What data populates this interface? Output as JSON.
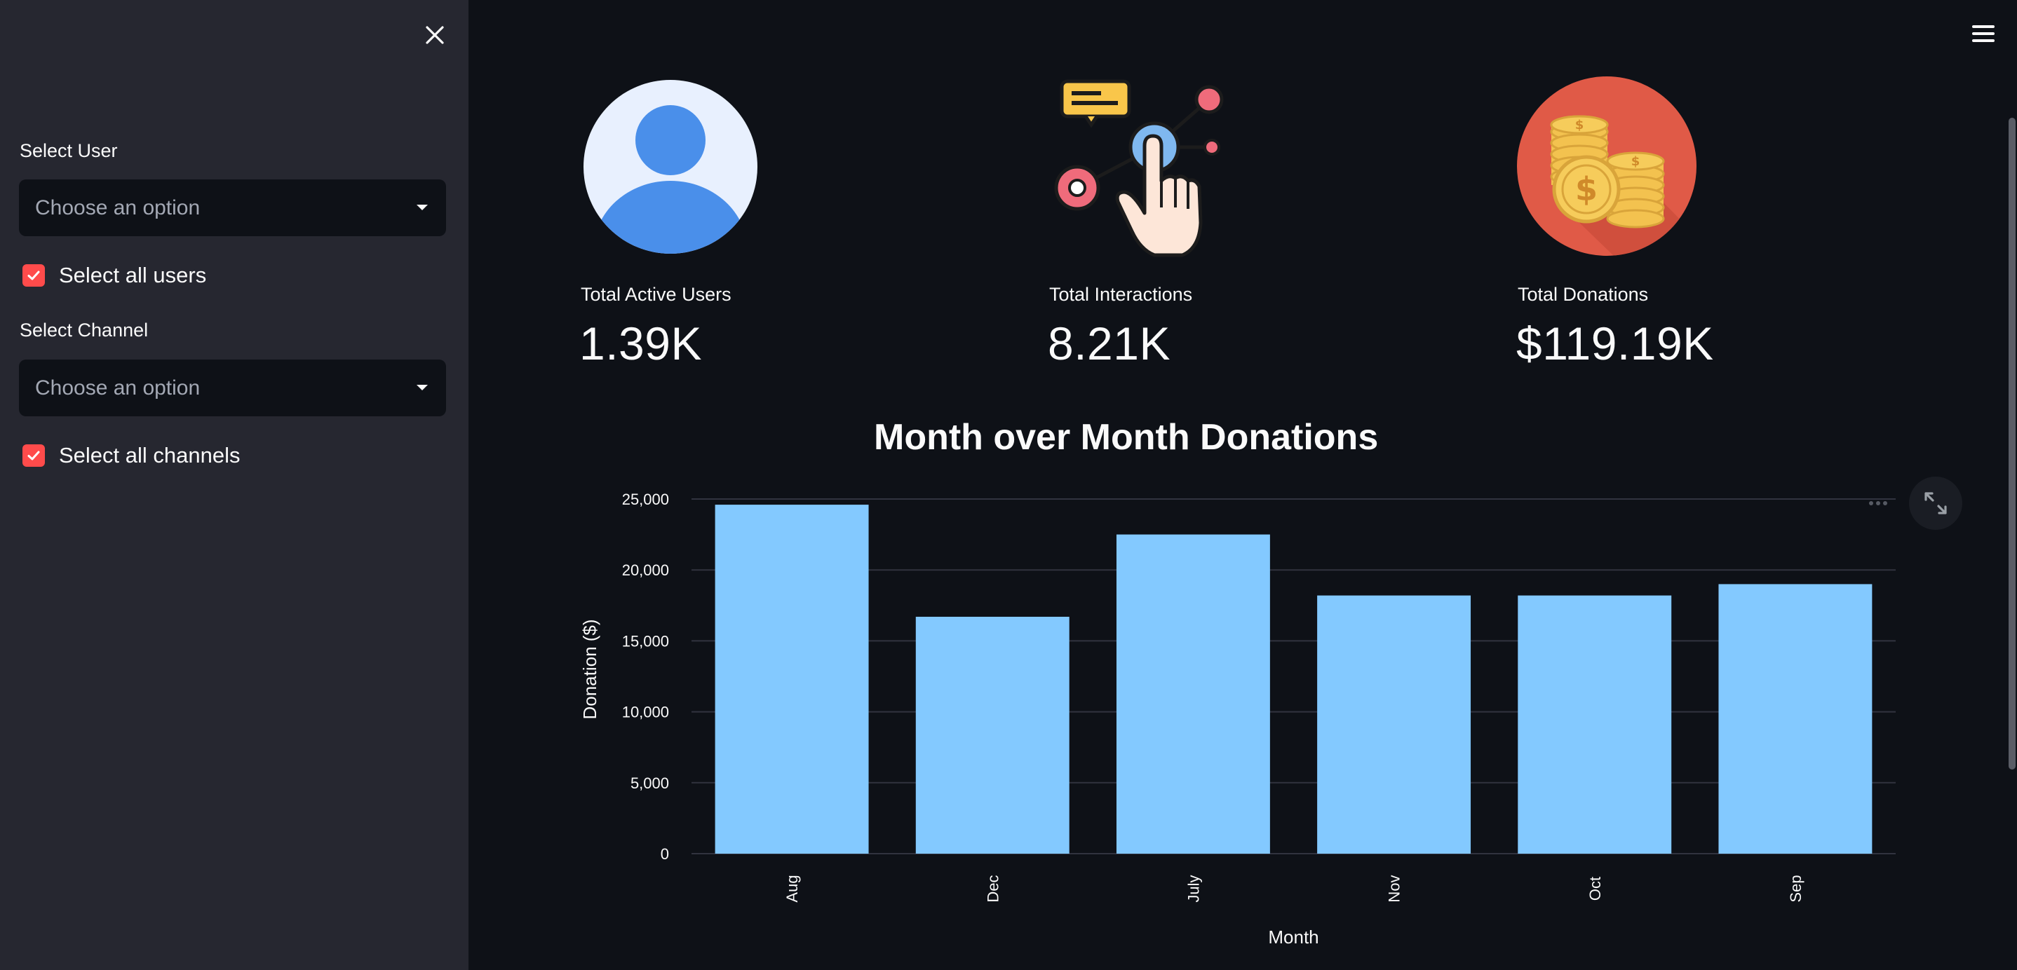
{
  "sidebar": {
    "select_user": {
      "label": "Select User",
      "placeholder": "Choose an option"
    },
    "select_all_users": {
      "label": "Select all users",
      "checked": true
    },
    "select_channel": {
      "label": "Select Channel",
      "placeholder": "Choose an option"
    },
    "select_all_channels": {
      "label": "Select all channels",
      "checked": true
    },
    "close_icon": "close-icon"
  },
  "header": {
    "menu_icon": "hamburger-menu-icon"
  },
  "metrics": [
    {
      "label": "Total Active Users",
      "value": "1.39K",
      "icon": "user-avatar-icon"
    },
    {
      "label": "Total Interactions",
      "value": "8.21K",
      "icon": "interaction-hand-icon"
    },
    {
      "label": "Total Donations",
      "value": "$119.19K",
      "icon": "coins-icon"
    }
  ],
  "colors": {
    "sidebar_bg": "#262730",
    "main_bg": "#0e1117",
    "accent": "#ff4b4b",
    "bar": "#83c9ff"
  },
  "chart_data": {
    "type": "bar",
    "title": "Month over Month Donations",
    "xlabel": "Month",
    "ylabel": "Donation ($)",
    "categories": [
      "Aug",
      "Dec",
      "July",
      "Nov",
      "Oct",
      "Sep"
    ],
    "values": [
      24600,
      16700,
      22500,
      18200,
      18200,
      19000
    ],
    "ylim": [
      0,
      25000
    ],
    "yticks": [
      0,
      5000,
      10000,
      15000,
      20000,
      25000
    ],
    "ytick_labels": [
      "0",
      "5,000",
      "10,000",
      "15,000",
      "20,000",
      "25,000"
    ],
    "grid": true,
    "color": "#83c9ff"
  }
}
